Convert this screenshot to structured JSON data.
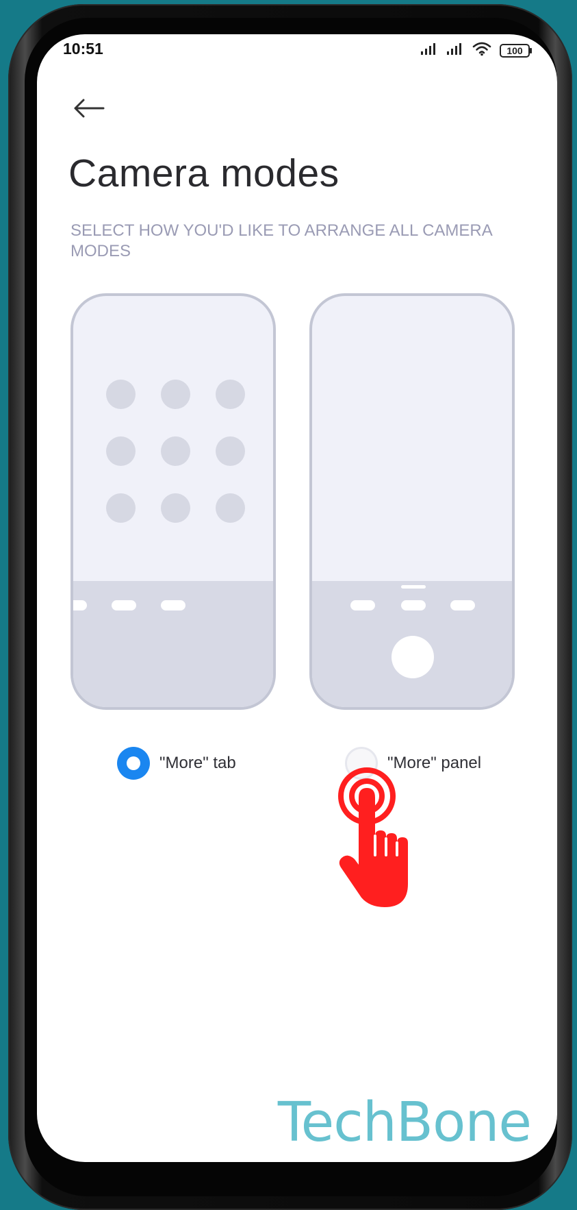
{
  "status_bar": {
    "time": "10:51",
    "battery": "100",
    "icons": [
      "signal-icon",
      "signal-icon",
      "wifi-icon",
      "battery-icon"
    ]
  },
  "header": {
    "back_icon": "arrow-left-icon",
    "title": "Camera modes"
  },
  "section_hint": "SELECT HOW YOU'D LIKE TO ARRANGE ALL CAMERA MODES",
  "options": [
    {
      "label": "\"More\" tab",
      "selected": true
    },
    {
      "label": "\"More\" panel",
      "selected": false
    }
  ],
  "overlay": {
    "tap_indicator_icon": "pointing-hand-icon",
    "tap_color": "#ff1f1f"
  },
  "watermark": "TechBone",
  "colors": {
    "accent": "#1a86f0",
    "background": "#157a88",
    "watermark": "#67c1cf"
  }
}
